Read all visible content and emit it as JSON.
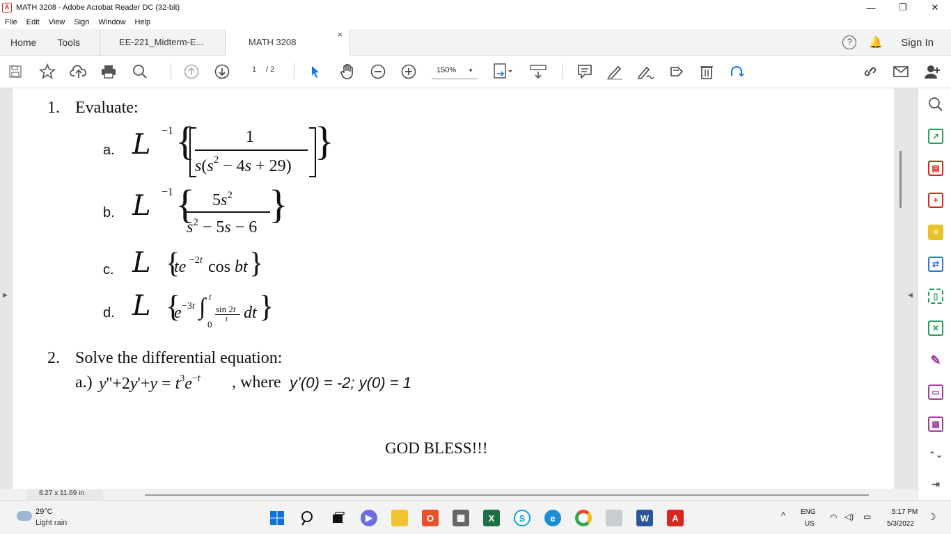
{
  "window": {
    "title": "MATH 3208 - Adobe Acrobat Reader DC (32-bit)",
    "minimize": "—",
    "maximize": "❐",
    "close": "✕"
  },
  "menu": [
    "File",
    "Edit",
    "View",
    "Sign",
    "Window",
    "Help"
  ],
  "tabs": {
    "home": "Home",
    "tools": "Tools",
    "doc1": "EE-221_Midterm-E...",
    "doc2": "MATH 3208",
    "close": "×",
    "signin": "Sign In"
  },
  "toolbar": {
    "current_page": "1",
    "total_pages": "/ 2",
    "zoom": "150%"
  },
  "document": {
    "q1_num": "1.",
    "q1_text": "Evaluate:",
    "a_label": "a.",
    "b_label": "b.",
    "c_label": "c.",
    "d_label": "d.",
    "q2_num": "2.",
    "q2_text": "Solve the differential equation:",
    "q2a_prefix": "a.)",
    "q2a_where": ", where",
    "q2a_conditions": "y’(0) = -2; y(0) = 1",
    "closing": "GOD BLESS!!!"
  },
  "status": {
    "page_size": "8.27 x 11.69 in"
  },
  "taskbar": {
    "temperature": "29°C",
    "condition": "Light rain",
    "lang1": "ENG",
    "lang2": "US",
    "time": "5:17 PM",
    "date": "5/3/2022"
  }
}
